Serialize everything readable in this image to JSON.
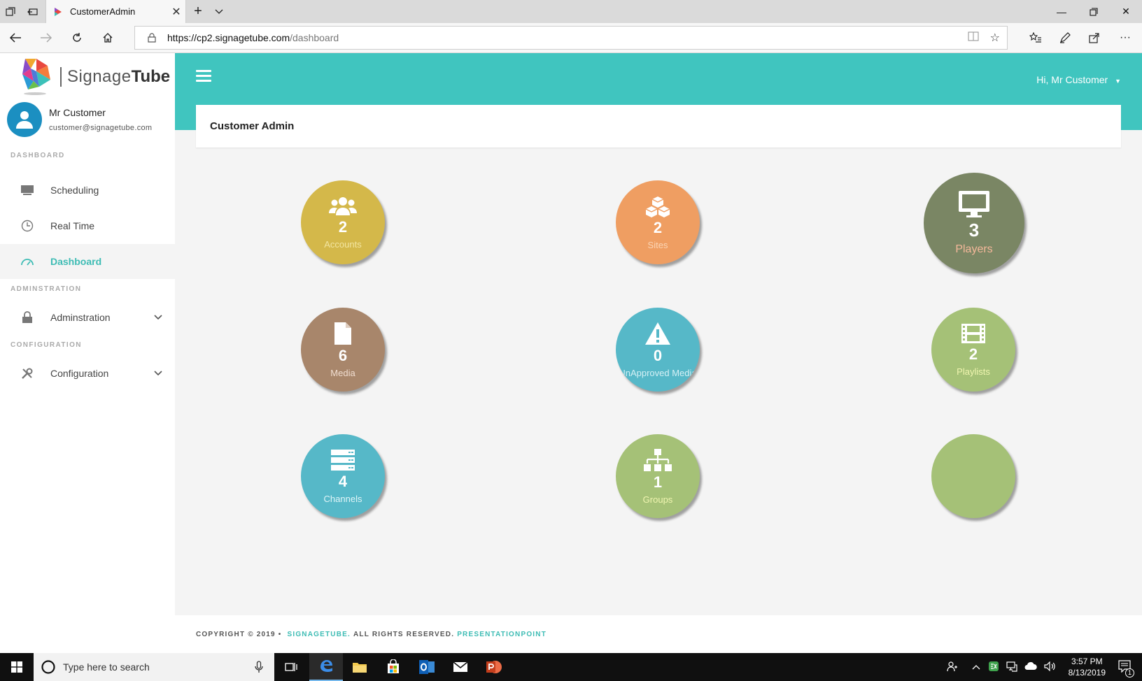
{
  "browser": {
    "tab_title": "CustomerAdmin",
    "url_host": "https://cp2.signagetube.com",
    "url_path": "/dashboard"
  },
  "brand": {
    "part_a": "Signage",
    "part_b": "Tube"
  },
  "user": {
    "name": "Mr Customer",
    "email": "customer@signagetube.com",
    "greeting": "Hi, Mr Customer"
  },
  "sidebar": {
    "sections": {
      "dashboard": "DASHBOARD",
      "administration": "ADMINSTRATION",
      "configuration": "CONFIGURATION"
    },
    "items": [
      {
        "label": "Scheduling",
        "icon": "monitor-icon"
      },
      {
        "label": "Real Time",
        "icon": "clock-icon"
      },
      {
        "label": "Dashboard",
        "icon": "gauge-icon",
        "active": true
      },
      {
        "label": "Adminstration",
        "icon": "lock-icon"
      },
      {
        "label": "Configuration",
        "icon": "tools-icon"
      }
    ]
  },
  "page": {
    "title": "Customer Admin"
  },
  "tiles": [
    {
      "count": "2",
      "label": "Accounts",
      "color": "#d4b84a",
      "label_color": "#f2e5a0",
      "icon": "users-icon"
    },
    {
      "count": "2",
      "label": "Sites",
      "color": "#ef9e62",
      "label_color": "#fbd5b5",
      "icon": "cubes-icon"
    },
    {
      "count": "3",
      "label": "Players",
      "color": "#7a8664",
      "label_color": "#f5b89a",
      "icon": "monitor-icon"
    },
    {
      "count": "6",
      "label": "Media",
      "color": "#a8866b",
      "label_color": "#f0ddd0",
      "icon": "file-icon"
    },
    {
      "count": "0",
      "label": "UnApproved Media",
      "color": "#56b8c8",
      "label_color": "#d4f0f5",
      "icon": "warning-icon"
    },
    {
      "count": "2",
      "label": "Playlists",
      "color": "#a5c177",
      "label_color": "#f0f5b0",
      "icon": "film-icon"
    },
    {
      "count": "4",
      "label": "Channels",
      "color": "#56b8c8",
      "label_color": "#e0f5f8",
      "icon": "server-icon"
    },
    {
      "count": "1",
      "label": "Groups",
      "color": "#a5c177",
      "label_color": "#f0f5b0",
      "icon": "sitemap-icon"
    },
    {
      "count": "",
      "label": "",
      "color": "#a5c177",
      "label_color": "#f0f5b0",
      "icon": ""
    }
  ],
  "footer": {
    "copyright": "COPYRIGHT © 2019 •",
    "brand": "SIGNAGETUBE.",
    "rights": "ALL RIGHTS RESERVED.",
    "partner": "PRESENTATIONPOINT"
  },
  "taskbar": {
    "search_placeholder": "Type here to search",
    "time": "3:57 PM",
    "date": "8/13/2019",
    "notification_count": "1"
  }
}
